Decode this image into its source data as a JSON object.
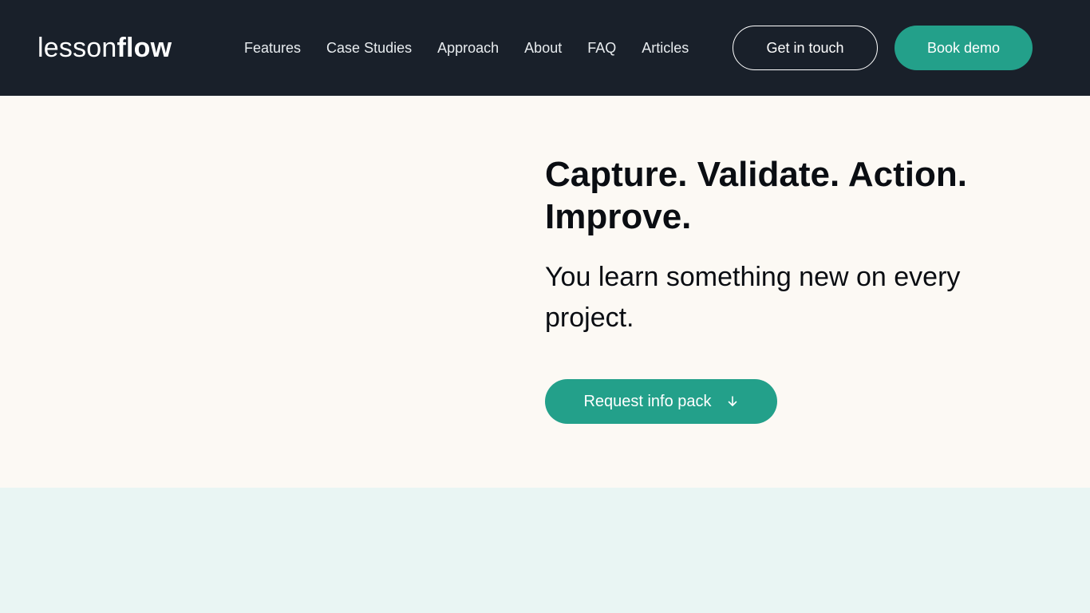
{
  "brand": {
    "logo_light": "lesson",
    "logo_bold": "flow"
  },
  "nav": {
    "links": [
      {
        "label": "Features"
      },
      {
        "label": "Case Studies"
      },
      {
        "label": "Approach"
      },
      {
        "label": "About"
      },
      {
        "label": "FAQ"
      },
      {
        "label": "Articles"
      }
    ],
    "get_in_touch_label": "Get in touch",
    "book_demo_label": "Book demo"
  },
  "hero": {
    "title": "Capture. Validate. Action. Improve.",
    "subtitle": "You learn something new on every project.",
    "cta_label": "Request info pack",
    "cta_icon": "arrow-down-icon"
  },
  "colors": {
    "nav_bg": "#19202a",
    "accent": "#23a08a",
    "hero_bg": "#fcf9f4",
    "lower_bg": "#e9f5f3",
    "text_dark": "#0a0d12"
  }
}
